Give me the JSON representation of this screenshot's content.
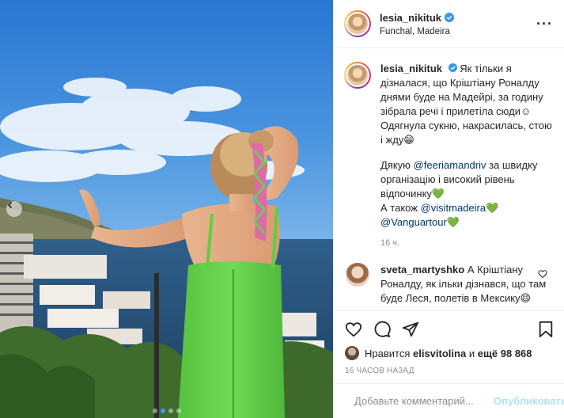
{
  "post": {
    "username": "lesia_nikituk",
    "location": "Funchal, Madeira",
    "caption": {
      "username": "lesia_nikituk",
      "text_1": "Як тільки я дізналася, що Кріштіану Роналду днями буде на Мадейрі, за годину зібрала речі і прилетіла сюди☺",
      "text_2": "Одягнула сукню, накрасилась, стою і жду😁",
      "thanks_prefix": "Дякую ",
      "mention_1": "@feeriamandriv",
      "thanks_suffix": " за швидку організацію і високий рівень відпочинку",
      "heart": "💚",
      "also": "А також ",
      "mention_2": "@visitmadeira",
      "mention_3": "@Vanguartour",
      "time": "16 ч."
    },
    "comment": {
      "username": "sveta_martyshko",
      "text": "А Кріштіану Роналду, як ільки дізнався, що там буде Леся, полетів в Мексику😄"
    },
    "likes": {
      "prefix": "Нравится ",
      "user": "elisvitolina",
      "middle": " и ",
      "count": "ещё 98 868"
    },
    "date": "16 ЧАСОВ НАЗАД",
    "add_comment": {
      "placeholder": "Добавьте комментарий...",
      "publish": "Опубликовать"
    }
  },
  "colors": {
    "sky": "#2f7fd6",
    "dress": "#6cd34f",
    "link": "#00376b",
    "publish_disabled": "#b2dffc",
    "verified": "#3897f0"
  },
  "carousel": {
    "count": 4,
    "active": 1
  }
}
